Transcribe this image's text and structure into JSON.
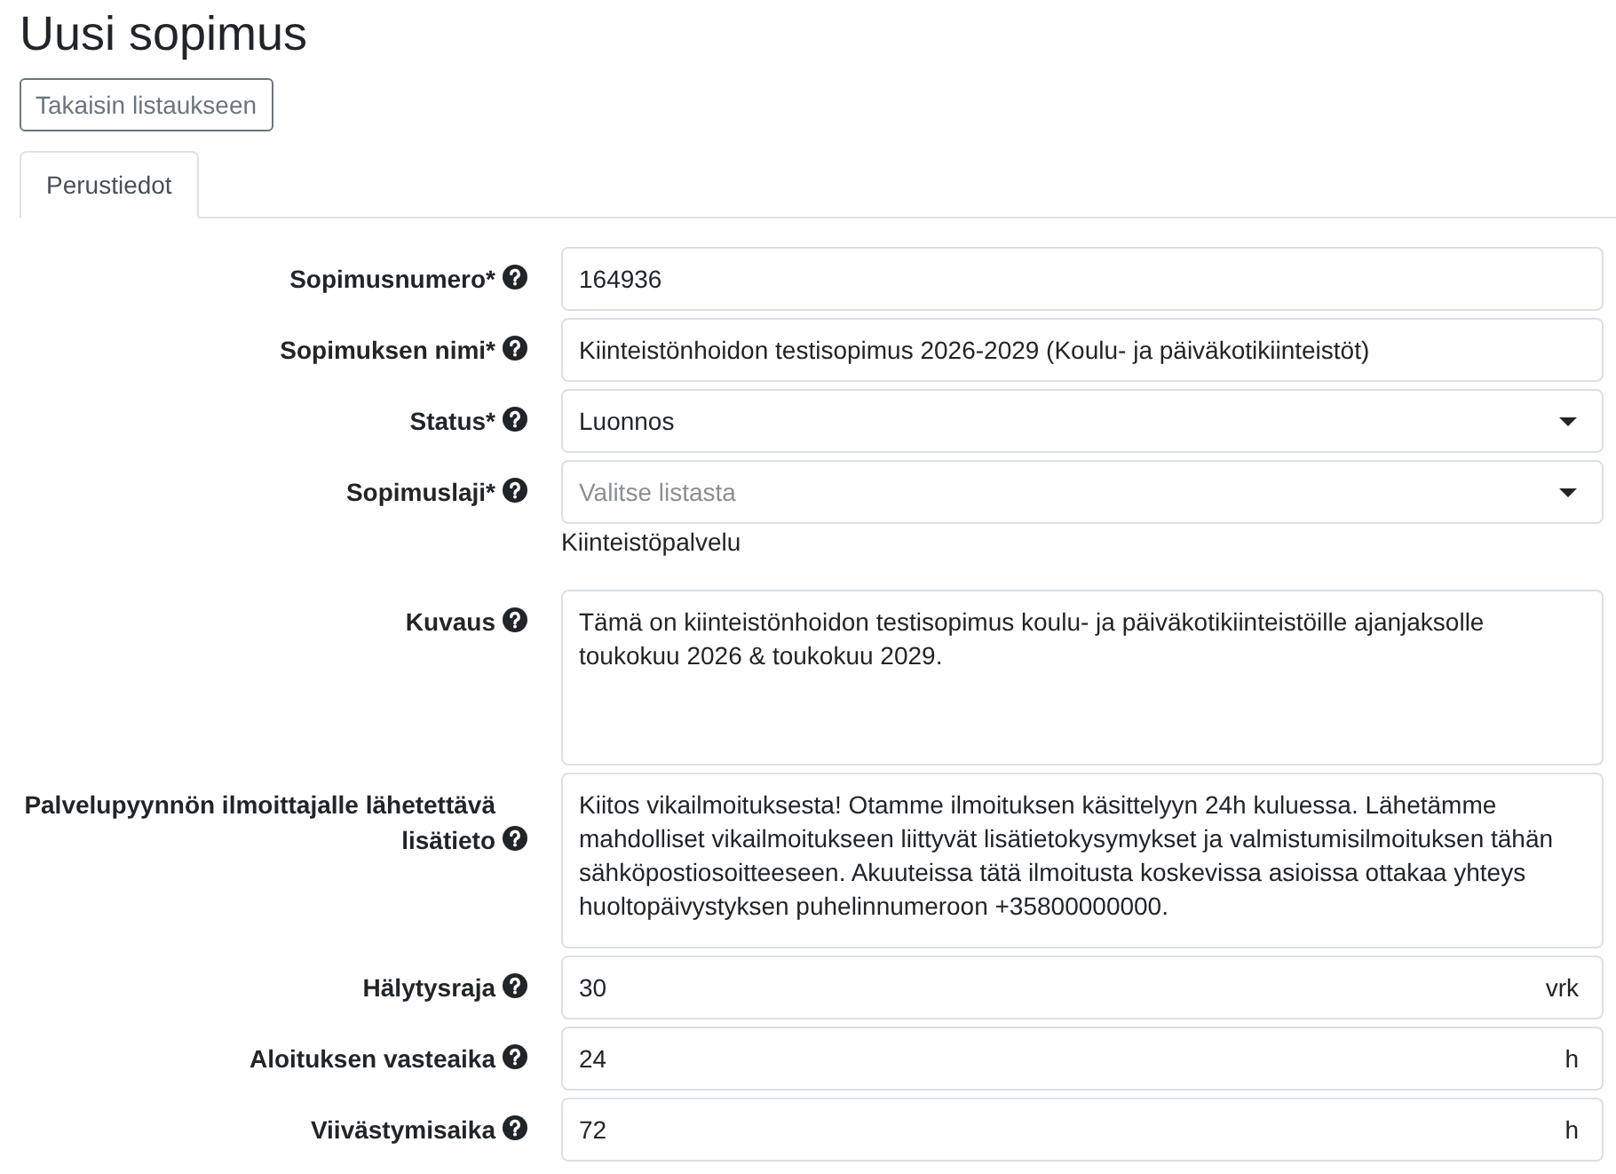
{
  "page": {
    "title": "Uusi sopimus"
  },
  "back_button": {
    "label": "Takaisin listaukseen"
  },
  "tabs": [
    {
      "label": "Perustiedot",
      "selected": true
    }
  ],
  "form": {
    "fields": [
      {
        "label": "Sopimusnumero*",
        "kind": "text",
        "value": "164936"
      },
      {
        "label": "Sopimuksen nimi*",
        "kind": "text",
        "value": "Kiinteistönhoidon testisopimus 2026-2029 (Koulu- ja päiväkotikiinteistöt)"
      },
      {
        "label": "Status*",
        "kind": "select",
        "value": "Luonnos"
      },
      {
        "label": "Sopimuslaji*",
        "kind": "select",
        "placeholder": "Valitse listasta",
        "note": "Kiinteistöpalvelu"
      },
      {
        "label": "Kuvaus",
        "kind": "textarea",
        "value": "Tämä on kiinteistönhoidon testisopimus koulu- ja päiväkotikiinteistöille ajanjaksolle toukokuu 2026 & toukokuu 2029."
      },
      {
        "label": "Palvelupyynnön ilmoittajalle lähetettävä lisätieto",
        "kind": "textarea",
        "value": "Kiitos vikailmoituksesta! Otamme ilmoituksen käsittelyyn 24h kuluessa. Lähetämme mahdolliset vikailmoitukseen liittyvät lisätietokysymykset ja valmistumisilmoituksen tähän sähköpostiosoitteeseen. Akuuteissa tätä ilmoitusta koskevissa asioissa ottakaa yhteys huoltopäivystyksen puhelinnumeroon +35800000000."
      },
      {
        "label": "Hälytysraja",
        "kind": "unit",
        "value": "30",
        "unit": "vrk"
      },
      {
        "label": "Aloituksen vasteaika",
        "kind": "unit",
        "value": "24",
        "unit": "h"
      },
      {
        "label": "Viivästymisaika",
        "kind": "unit",
        "value": "72",
        "unit": "h"
      }
    ]
  }
}
